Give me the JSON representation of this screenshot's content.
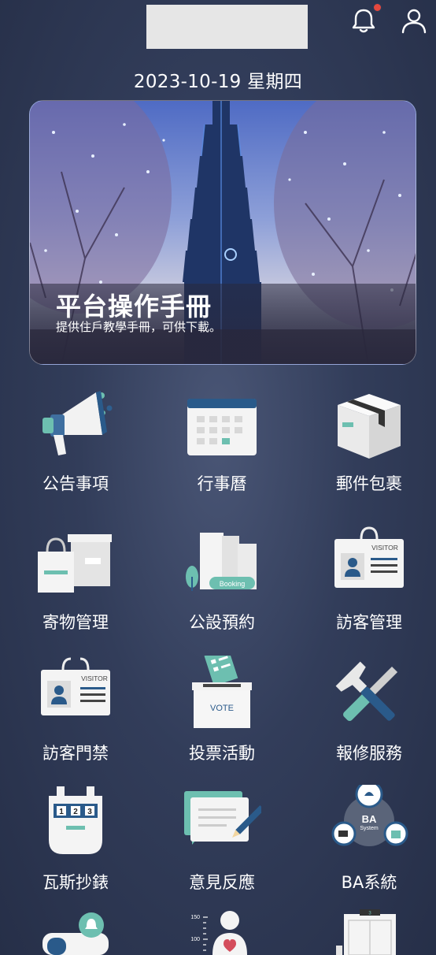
{
  "header": {
    "notification_icon": "bell-icon",
    "profile_icon": "user-icon"
  },
  "date": "2023-10-19 星期四",
  "banner": {
    "title": "平台操作手冊",
    "subtitle": "提供住戶教學手冊，可供下載。"
  },
  "menu": [
    {
      "label": "公告事項",
      "icon": "megaphone-icon"
    },
    {
      "label": "行事曆",
      "icon": "calendar-icon"
    },
    {
      "label": "郵件包裹",
      "icon": "package-icon"
    },
    {
      "label": "寄物管理",
      "icon": "storage-bags-icon"
    },
    {
      "label": "公設預約",
      "icon": "booking-building-icon"
    },
    {
      "label": "訪客管理",
      "icon": "visitor-badge-icon"
    },
    {
      "label": "訪客門禁",
      "icon": "visitor-access-icon"
    },
    {
      "label": "投票活動",
      "icon": "vote-box-icon"
    },
    {
      "label": "報修服務",
      "icon": "repair-tools-icon"
    },
    {
      "label": "瓦斯抄錶",
      "icon": "gas-meter-icon"
    },
    {
      "label": "意見反應",
      "icon": "feedback-icon"
    },
    {
      "label": "BA系統",
      "icon": "ba-system-icon"
    }
  ],
  "icon_texts": {
    "booking": "Booking",
    "visitor": "VISITOR",
    "vote": "VOTE",
    "meter_digits": [
      "1",
      "2",
      "3"
    ],
    "ba_title": "BA",
    "ba_sub": "System",
    "scale_150": "150",
    "scale_100": "100",
    "elevator_floor": "3"
  }
}
